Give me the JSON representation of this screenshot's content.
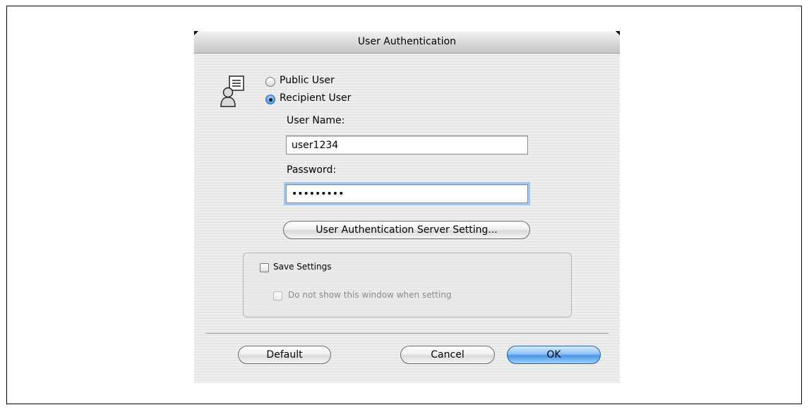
{
  "dialog": {
    "title": "User Authentication",
    "user_type": {
      "options": [
        {
          "label": "Public User",
          "selected": false
        },
        {
          "label": "Recipient User",
          "selected": true
        }
      ]
    },
    "user_name": {
      "label": "User Name:",
      "value": "user1234"
    },
    "password": {
      "label": "Password:",
      "value": "•••••••••"
    },
    "server_setting_label": "User Authentication Server Setting...",
    "save_settings": {
      "label": "Save Settings",
      "checked": false,
      "sub_option": {
        "label": "Do not show this window when setting",
        "checked": false,
        "enabled": false
      }
    },
    "buttons": {
      "default_label": "Default",
      "cancel_label": "Cancel",
      "ok_label": "OK"
    }
  },
  "icons": {
    "user": "user-with-document-icon"
  },
  "colors": {
    "accent": "#4a95e6",
    "focus_ring": "#a8c6ec"
  }
}
